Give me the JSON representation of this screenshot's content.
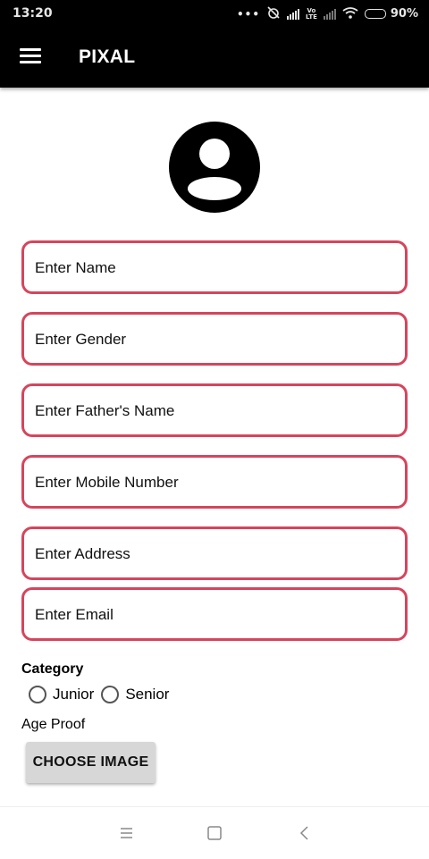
{
  "status_bar": {
    "time": "13:20",
    "volte_label": "Vo",
    "lte_label": "LTE",
    "battery": "90%",
    "battery_level": 0.9,
    "icons": [
      "more-dots-icon",
      "alarm-off-icon",
      "signal-icon",
      "volte-icon",
      "signal-weak-icon",
      "wifi-icon",
      "battery-icon"
    ]
  },
  "app_bar": {
    "title": "PIXAL",
    "menu_icon": "hamburger-menu-icon"
  },
  "profile": {
    "avatar_icon": "account-circle-icon"
  },
  "form": {
    "fields": [
      {
        "placeholder": "Enter Name",
        "value": ""
      },
      {
        "placeholder": "Enter Gender",
        "value": ""
      },
      {
        "placeholder": "Enter Father's Name",
        "value": ""
      },
      {
        "placeholder": "Enter Mobile Number",
        "value": ""
      },
      {
        "placeholder": "Enter Address",
        "value": ""
      },
      {
        "placeholder": "Enter Email",
        "value": ""
      }
    ],
    "category_label": "Category",
    "category_options": [
      "Junior",
      "Senior"
    ],
    "age_proof_label": "Age Proof",
    "choose_image_label": "CHOOSE IMAGE"
  },
  "nav_bar": {
    "icons": [
      "recents-icon",
      "home-icon",
      "back-icon"
    ]
  },
  "colors": {
    "app_bar": "#000000",
    "field_border": "#d6455d",
    "button_bg": "#d7d7d7"
  }
}
